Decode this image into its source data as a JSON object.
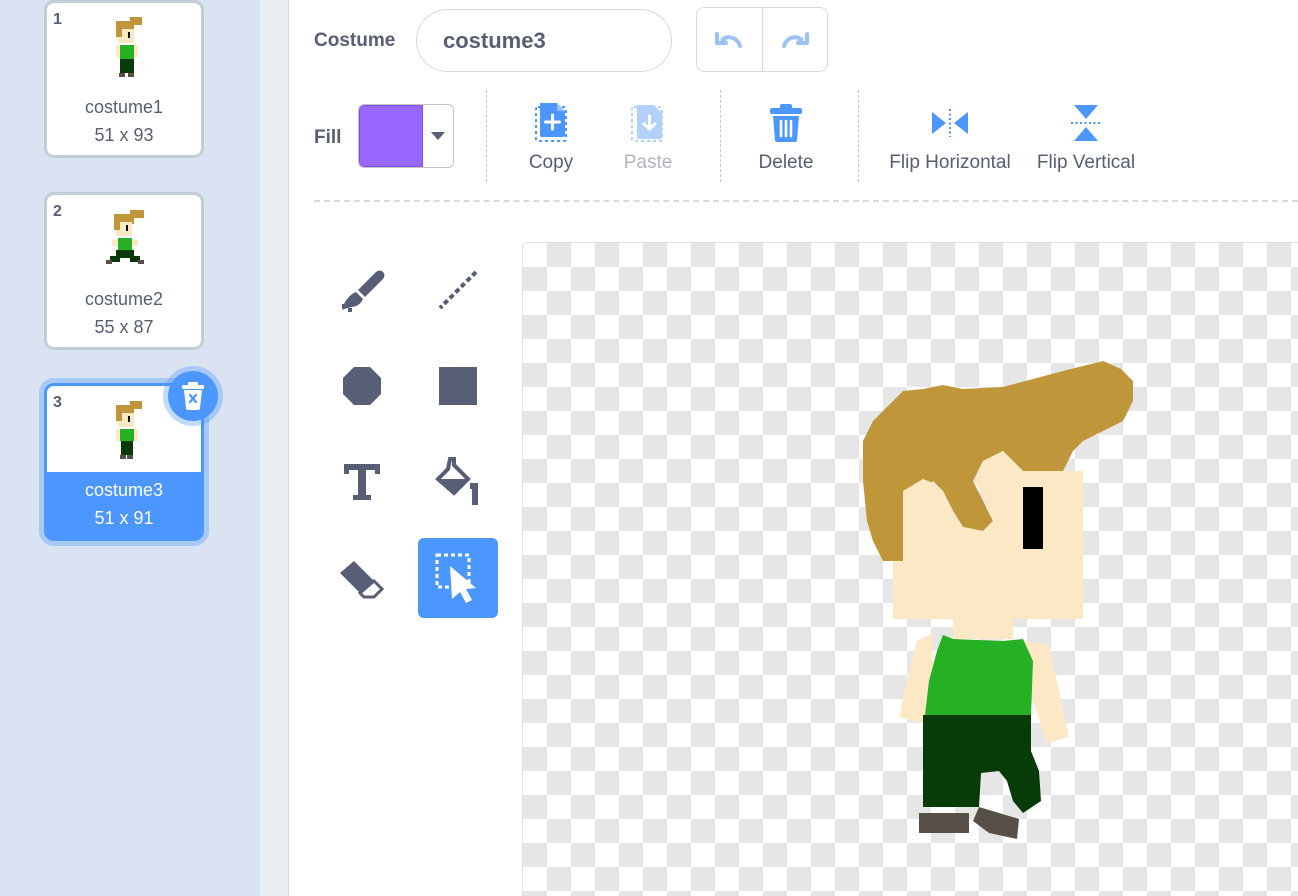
{
  "costumes": [
    {
      "number": "1",
      "name": "costume1",
      "size": "51 x 93"
    },
    {
      "number": "2",
      "name": "costume2",
      "size": "55 x 87"
    },
    {
      "number": "3",
      "name": "costume3",
      "size": "51 x 91"
    }
  ],
  "header": {
    "costume_label": "Costume",
    "costume_name": "costume3"
  },
  "fill": {
    "label": "Fill",
    "color": "#9966ff"
  },
  "actions": {
    "copy": "Copy",
    "paste": "Paste",
    "delete": "Delete",
    "flip_horizontal": "Flip Horizontal",
    "flip_vertical": "Flip Vertical"
  },
  "tools": [
    "brush",
    "line",
    "circle",
    "rectangle",
    "text",
    "fill",
    "eraser",
    "select"
  ],
  "active_tool": "select",
  "colors": {
    "accent": "#4c97ff",
    "sidebar": "#d9e3f2",
    "text": "#575e75",
    "hair": "#c0963a",
    "skin": "#fde8c6",
    "shirt": "#26b023",
    "pants": "#073b07",
    "shoes": "#575048"
  }
}
